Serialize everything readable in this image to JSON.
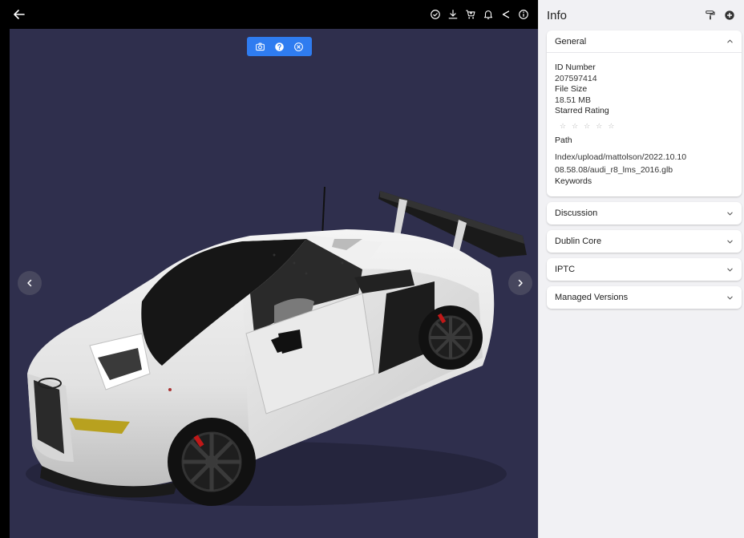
{
  "viewer": {
    "back_icon": "arrow-left-icon",
    "toolbar_icons": [
      "check-circle-icon",
      "download-icon",
      "cart-icon",
      "bell-icon",
      "share-icon",
      "info-icon"
    ],
    "model_toolbar_icons": [
      "camera-icon",
      "help-icon",
      "close-circle-icon"
    ],
    "background_color": "#2f2f4d",
    "accent_color": "#2f7cf0"
  },
  "panel": {
    "title": "Info",
    "action_icons": [
      "paint-roller-icon",
      "add-circle-icon"
    ],
    "sections": {
      "general": {
        "title": "General",
        "id_label": "ID Number",
        "id_value": "207597414",
        "size_label": "File Size",
        "size_value": "18.51 MB",
        "rating_label": "Starred Rating",
        "rating_value": 0,
        "rating_max": 5,
        "path_label": "Path",
        "path_value": "Index/upload/mattolson/2022.10.10 08.58.08/audi_r8_lms_2016.glb",
        "keywords_label": "Keywords"
      },
      "discussion": {
        "title": "Discussion"
      },
      "dublin_core": {
        "title": "Dublin Core"
      },
      "iptc": {
        "title": "IPTC"
      },
      "managed_versions": {
        "title": "Managed Versions"
      }
    }
  }
}
